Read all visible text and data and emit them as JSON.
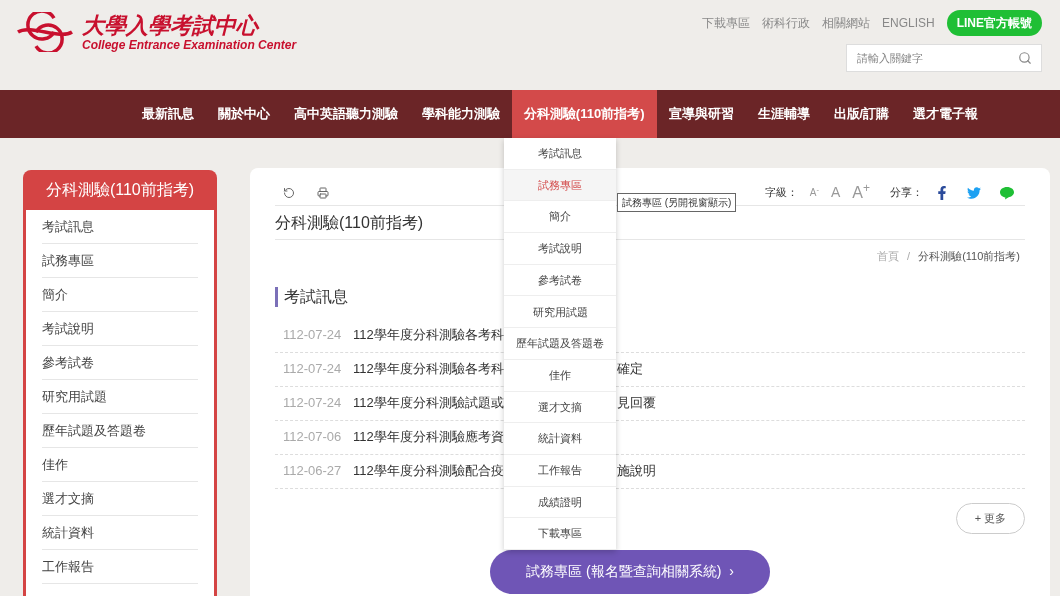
{
  "logo": {
    "title": "大學入學考試中心",
    "subtitle": "College Entrance Examination Center"
  },
  "top_links": [
    "下載專區",
    "術科行政",
    "相關網站",
    "ENGLISH"
  ],
  "line_button": "LINE官方帳號",
  "search": {
    "placeholder": "請輸入關鍵字"
  },
  "nav": [
    {
      "label": "最新訊息",
      "selected": false
    },
    {
      "label": "關於中心",
      "selected": false
    },
    {
      "label": "高中英語聽力測驗",
      "selected": false
    },
    {
      "label": "學科能力測驗",
      "selected": false
    },
    {
      "label": "分科測驗(110前指考)",
      "selected": true
    },
    {
      "label": "宣導與研習",
      "selected": false
    },
    {
      "label": "生涯輔導",
      "selected": false
    },
    {
      "label": "出版/訂購",
      "selected": false
    },
    {
      "label": "選才電子報",
      "selected": false
    }
  ],
  "dropdown": [
    {
      "label": "考試訊息",
      "selected": false
    },
    {
      "label": "試務專區",
      "selected": true
    },
    {
      "label": "簡介",
      "selected": false
    },
    {
      "label": "考試說明",
      "selected": false
    },
    {
      "label": "參考試卷",
      "selected": false
    },
    {
      "label": "研究用試題",
      "selected": false
    },
    {
      "label": "歷年試題及答題卷",
      "selected": false
    },
    {
      "label": "佳作",
      "selected": false
    },
    {
      "label": "選才文摘",
      "selected": false
    },
    {
      "label": "統計資料",
      "selected": false
    },
    {
      "label": "工作報告",
      "selected": false
    },
    {
      "label": "成績證明",
      "selected": false
    },
    {
      "label": "下載專區",
      "selected": false
    }
  ],
  "tooltip": "試務專區 (另開視窗顯示)",
  "sidebar": {
    "title": "分科測驗(110前指考)",
    "items": [
      "考試訊息",
      "試務專區",
      "簡介",
      "考試說明",
      "參考試卷",
      "研究用試題",
      "歷年試題及答題卷",
      "佳作",
      "選才文摘",
      "統計資料",
      "工作報告"
    ]
  },
  "toolbar": {
    "font_size_label": "字級：",
    "font_sizes": [
      "A$^{-}$",
      "A",
      "A$^{+}$"
    ],
    "share_label": "分享："
  },
  "page_title": "分科測驗(110前指考)",
  "breadcrumb": [
    "首頁",
    "/",
    "分科測驗(110前指考)"
  ],
  "section_title": "考試訊息",
  "news": [
    {
      "date": "112-07-24",
      "title_start": "112學年度分科測驗各考科"
    },
    {
      "date": "112-07-24",
      "title_start": "112學年度分科測驗各考科",
      "title_end": "確定"
    },
    {
      "date": "112-07-24",
      "title_start": "112學年度分科測驗試題或",
      "title_end": "見回覆"
    },
    {
      "date": "112-07-06",
      "title_start": "112學年度分科測驗應考資"
    },
    {
      "date": "112-06-27",
      "title_start": "112學年度分科測驗配合疫",
      "title_end": "施說明"
    }
  ],
  "more_button": "+ 更多",
  "portal_button": "試務專區 (報名暨查詢相關系統)  ›"
}
